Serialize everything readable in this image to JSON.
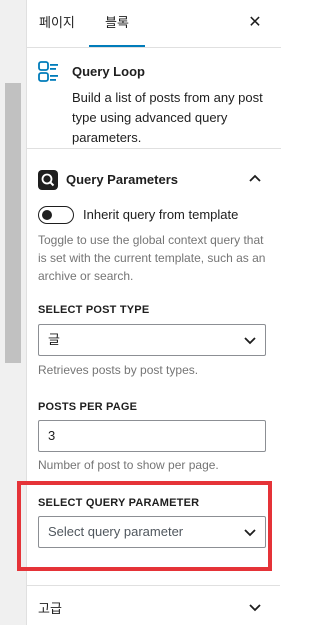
{
  "tabs": {
    "page": "페이지",
    "block": "블록",
    "close_icon": "close-icon"
  },
  "block_card": {
    "icon": "query-loop-icon",
    "title": "Query Loop",
    "description": "Build a list of posts from any post type using advanced query parameters.",
    "accent_color": "#007cba"
  },
  "query_params": {
    "icon": "search-square-icon",
    "title": "Query Parameters",
    "toggle_label": "Inherit query from template",
    "toggle_checked": false,
    "toggle_help": "Toggle to use the global context query that is set with the current template, such as an archive or search.",
    "post_type": {
      "label": "SELECT POST TYPE",
      "value": "글",
      "help": "Retrieves posts by post types."
    },
    "per_page": {
      "label": "POSTS PER PAGE",
      "value": "3",
      "help": "Number of post to show per page."
    },
    "query_parameter": {
      "label": "SELECT QUERY PARAMETER",
      "placeholder": "Select query parameter",
      "highlight_color": "#e53338"
    }
  },
  "advanced": {
    "label": "고급"
  }
}
